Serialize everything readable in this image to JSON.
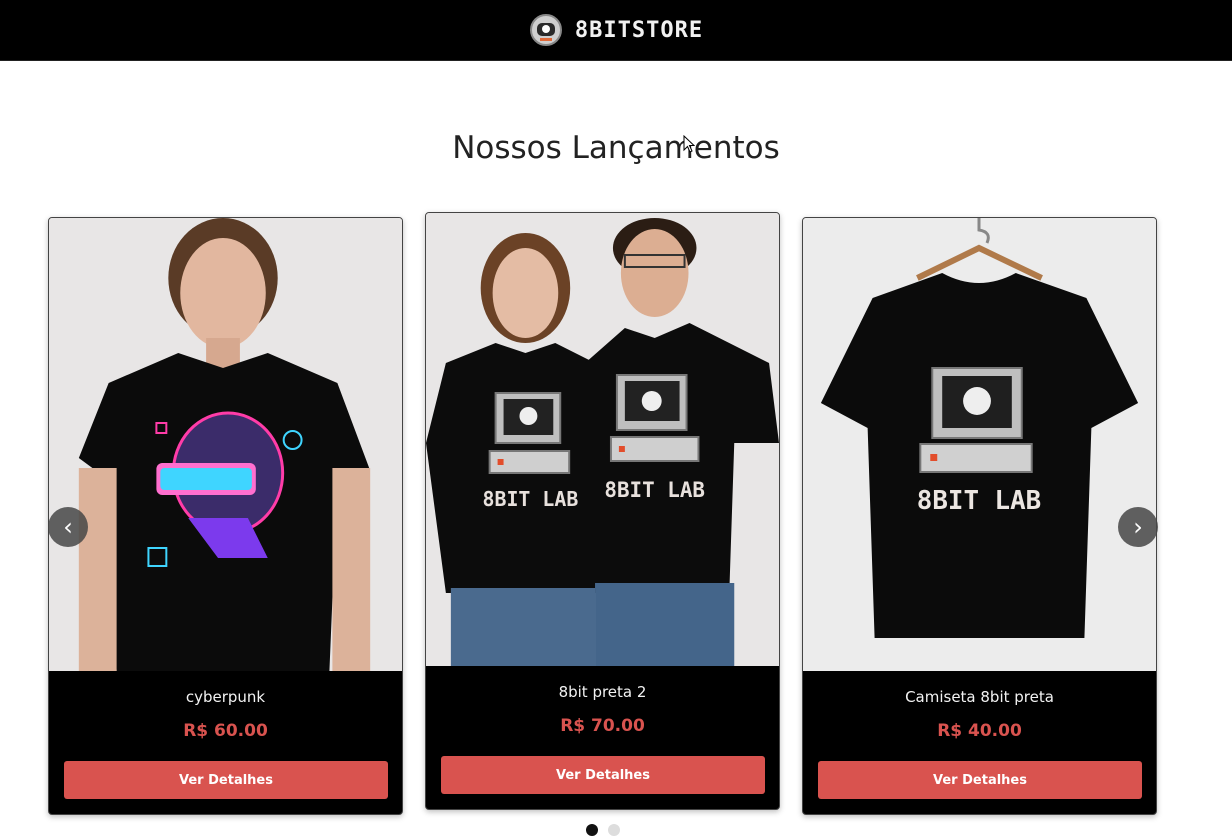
{
  "header": {
    "logo_text": "8BITSTORE",
    "logo_icon": "astronaut-helmet-icon"
  },
  "section": {
    "title": "Nossos Lançamentos"
  },
  "carousel": {
    "prev_label": "‹",
    "next_label": "›",
    "products": [
      {
        "name": "cyberpunk",
        "price": "R$ 60.00",
        "button": "Ver Detalhes",
        "image": "woman-cyberpunk-tshirt"
      },
      {
        "name": "8bit preta 2",
        "price": "R$ 70.00",
        "button": "Ver Detalhes",
        "image": "couple-8bit-lab-tshirts",
        "print_text": "8BIT LAB"
      },
      {
        "name": "Camiseta 8bit preta",
        "price": "R$ 40.00",
        "button": "Ver Detalhes",
        "image": "hanger-8bit-lab-tshirt",
        "print_text": "8BIT LAB"
      }
    ],
    "dots": 2,
    "active_dot": 0
  },
  "colors": {
    "header_bg": "#000000",
    "accent": "#d9534f",
    "card_bg": "#000000"
  }
}
